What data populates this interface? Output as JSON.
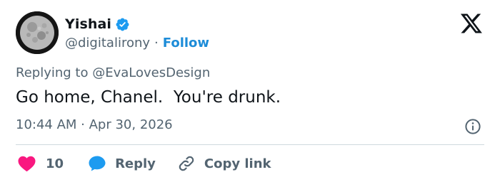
{
  "author": {
    "name": "Yishai",
    "handle": "@digitalirony",
    "separator": "·",
    "follow_label": "Follow"
  },
  "reply_context": "Replying to @EvaLovesDesign",
  "tweet": {
    "text": "Go home, Chanel.  You're drunk.",
    "timestamp": "10:44 AM · Apr 30, 2026"
  },
  "actions": {
    "like_count": "10",
    "reply_label": "Reply",
    "copy_link_label": "Copy link"
  },
  "icons": {
    "avatar": "moon-avatar",
    "verified": "verified-badge-icon",
    "brand": "x-logo-icon",
    "info": "info-icon",
    "like": "heart-icon",
    "reply": "speech-bubble-icon",
    "copy": "link-icon"
  },
  "colors": {
    "text": "#0f1419",
    "secondary": "#536471",
    "accent": "#1d8cd8",
    "like": "#f91880",
    "verified": "#1d9bf0",
    "divider": "#cfd9de"
  }
}
